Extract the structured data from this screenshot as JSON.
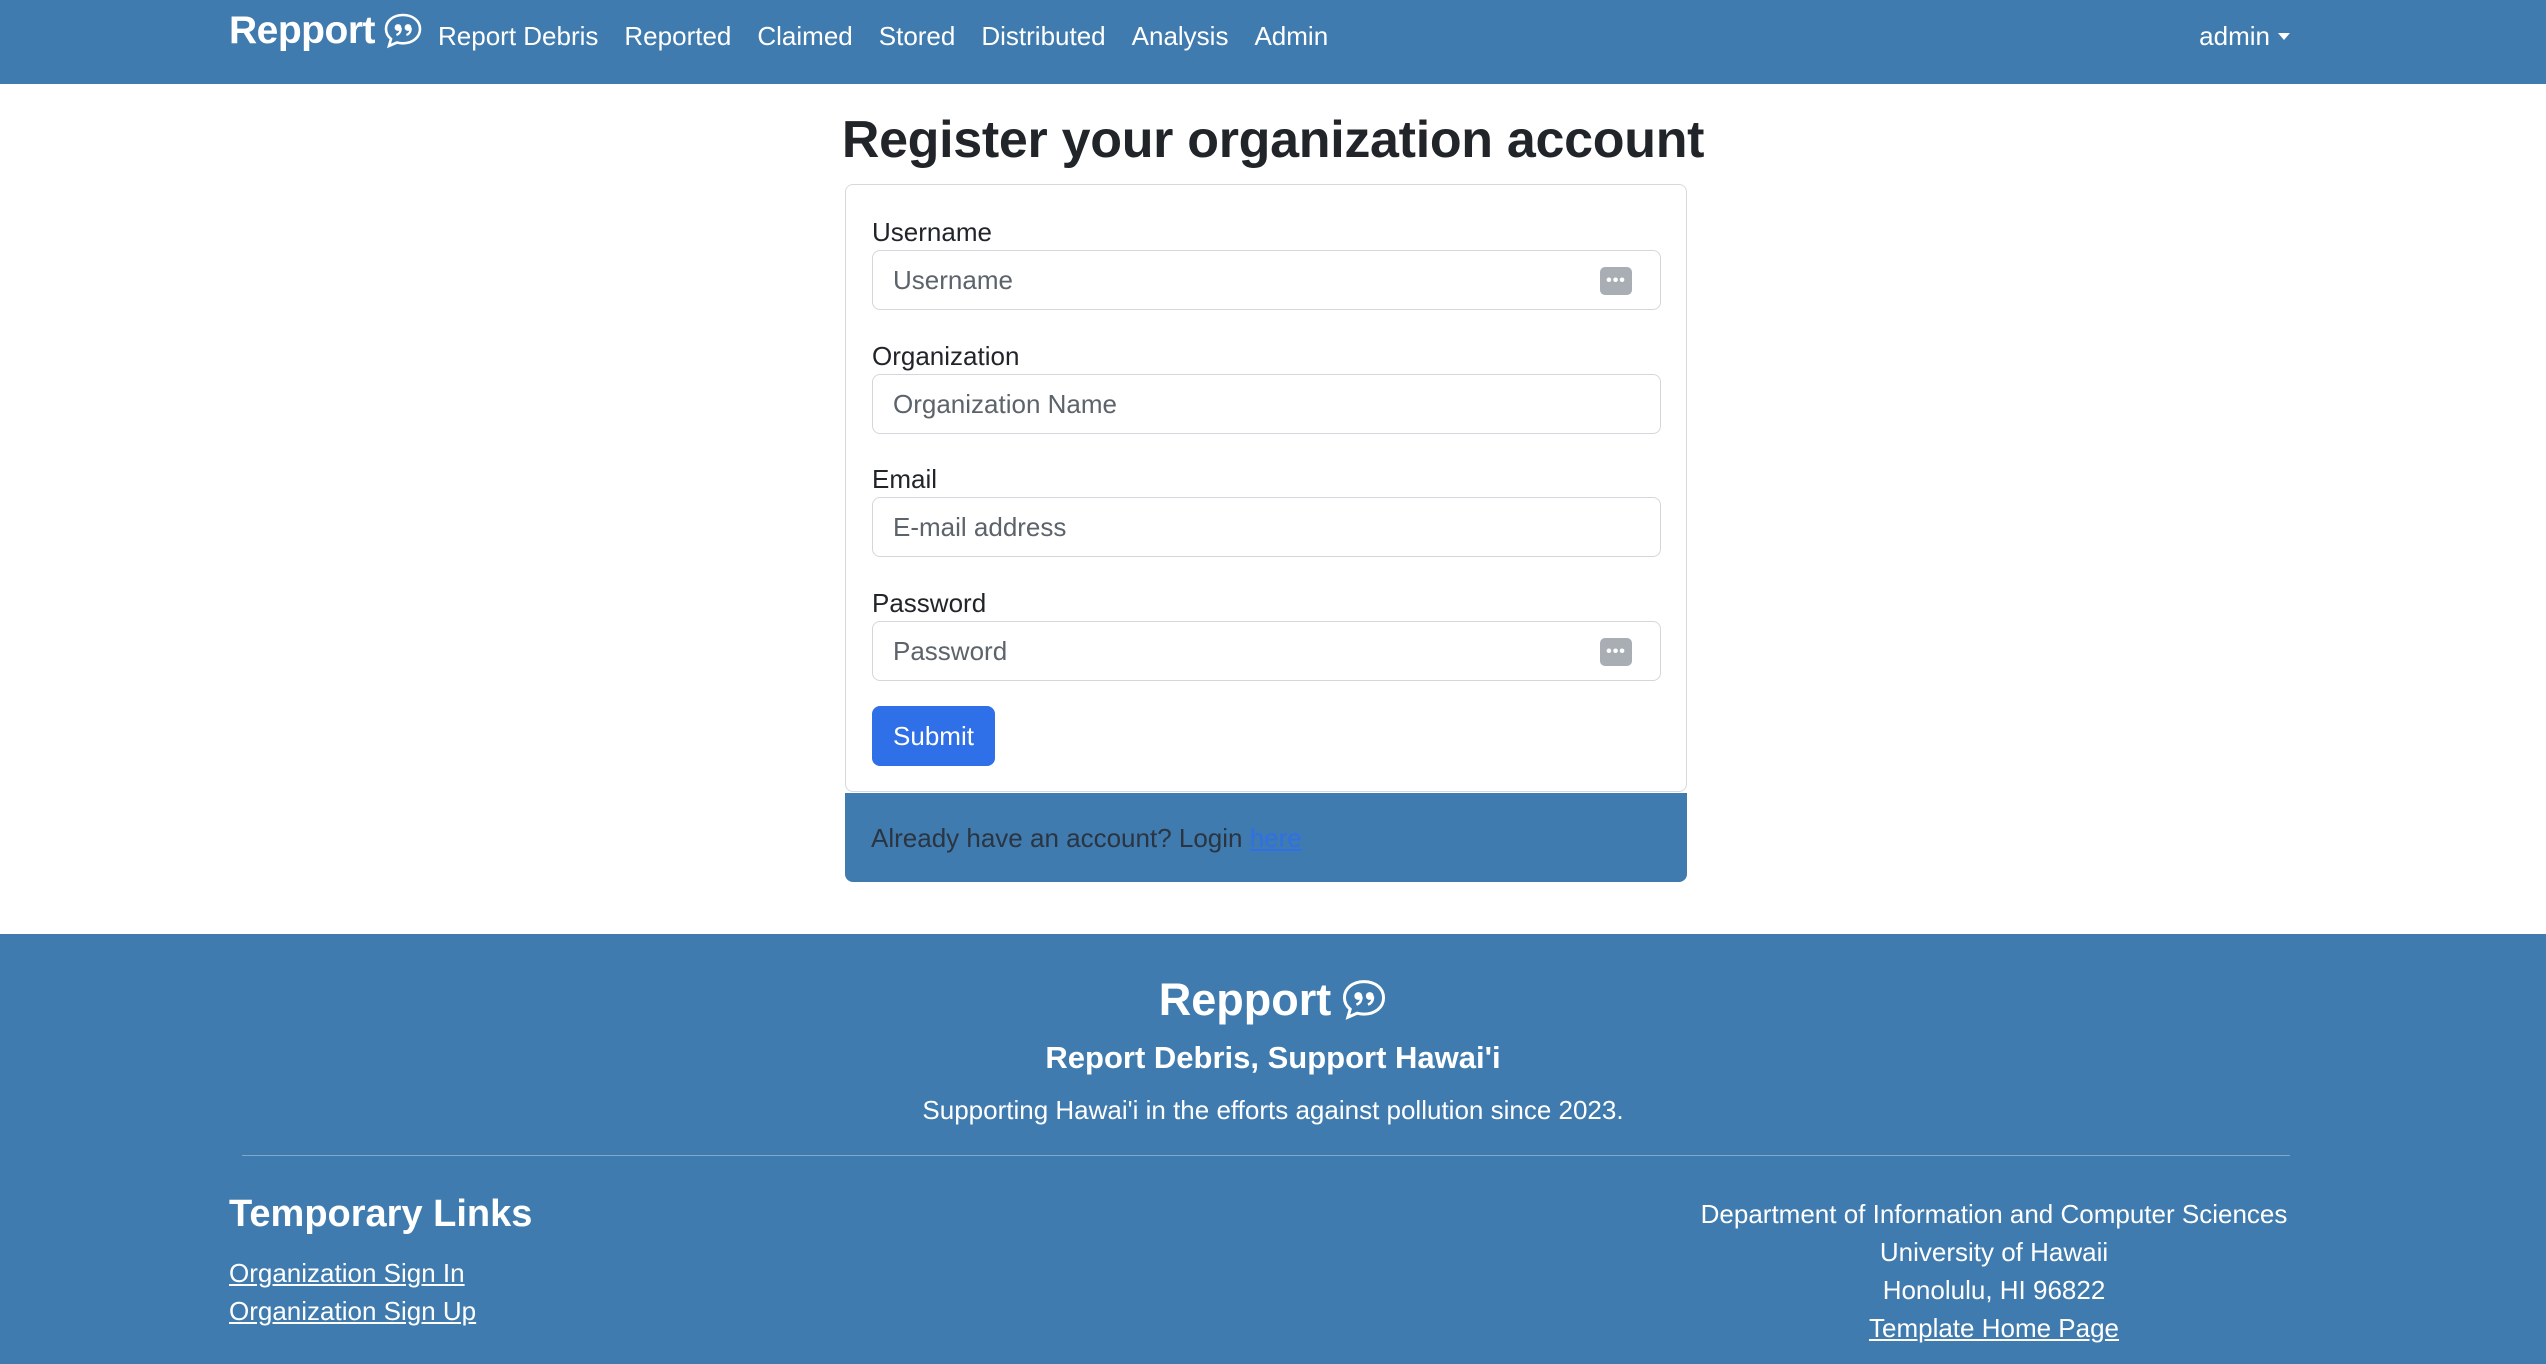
{
  "navbar": {
    "brand": "Repport",
    "links": [
      "Report Debris",
      "Reported",
      "Claimed",
      "Stored",
      "Distributed",
      "Analysis",
      "Admin"
    ],
    "user_menu": "admin"
  },
  "main": {
    "title": "Register your organization account",
    "form": {
      "username": {
        "label": "Username",
        "placeholder": "Username"
      },
      "organization": {
        "label": "Organization",
        "placeholder": "Organization Name"
      },
      "email": {
        "label": "Email",
        "placeholder": "E-mail address"
      },
      "password": {
        "label": "Password",
        "placeholder": "Password"
      },
      "submit_label": "Submit"
    },
    "login_prompt": "Already have an account? Login ",
    "login_link": "here"
  },
  "footer": {
    "brand": "Repport",
    "tagline": "Report Debris, Support Hawai'i",
    "subtitle": "Supporting Hawai'i in the efforts against pollution since 2023.",
    "links_title": "Temporary Links",
    "links": [
      "Organization Sign In",
      "Organization Sign Up"
    ],
    "address": [
      "Department of Information and Computer Sciences",
      "University of Hawaii",
      "Honolulu, HI 96822"
    ],
    "home_link": "Template Home Page"
  },
  "colors": {
    "navbar_bg": "#3f7bae",
    "primary_button": "#2f6fe8"
  },
  "icons": {
    "brand": "speech-bubble-quote-icon",
    "password_manager": "key-dots-icon"
  }
}
